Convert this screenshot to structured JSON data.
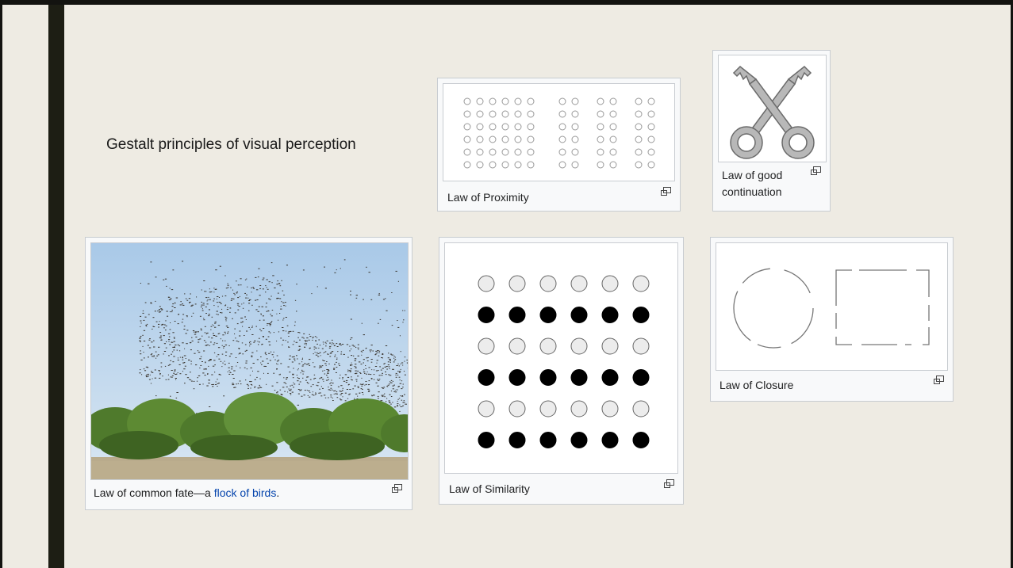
{
  "slide": {
    "title": "Gestalt principles of visual perception"
  },
  "figures": {
    "proximity": {
      "caption": "Law of Proximity"
    },
    "continuation": {
      "caption_line1": "Law of good",
      "caption_line2": "continuation"
    },
    "common_fate": {
      "caption_prefix": "Law of common fate—a ",
      "caption_link": "flock of birds",
      "caption_suffix": "."
    },
    "similarity": {
      "caption": "Law of Similarity"
    },
    "closure": {
      "caption": "Law of Closure"
    }
  },
  "icons": {
    "enlarge": "magnify-clip-icon"
  },
  "colors": {
    "background": "#eeebe3",
    "accent_bar": "#1d1e14",
    "link": "#0645ad"
  }
}
